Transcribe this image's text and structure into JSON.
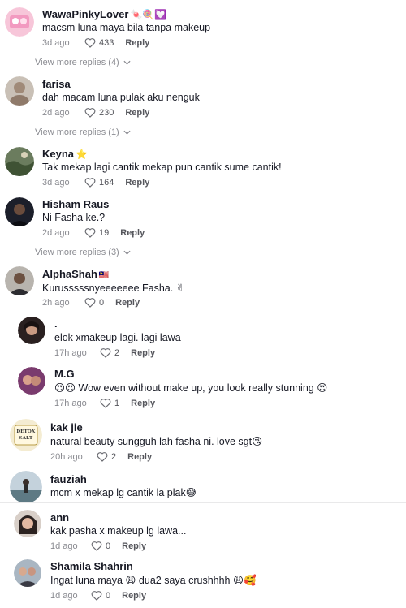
{
  "comments": [
    {
      "name": "WawaPinkyLover",
      "name_emoji": "🍬🍭💟",
      "text": "macsm luna maya bila tanpa makeup",
      "time": "3d ago",
      "likes": "433",
      "reply": "Reply"
    },
    {
      "name": "farisa",
      "name_emoji": "",
      "text": "dah macam luna pulak aku nenguk",
      "time": "2d ago",
      "likes": "230",
      "reply": "Reply"
    },
    {
      "name": "Keyna",
      "name_emoji": "⭐",
      "text": "Tak mekap lagi cantik mekap pun cantik sume cantik!",
      "time": "3d ago",
      "likes": "164",
      "reply": "Reply"
    },
    {
      "name": "Hisham Raus",
      "name_emoji": "",
      "text": "Ni Fasha ke.?",
      "time": "2d ago",
      "likes": "19",
      "reply": "Reply"
    },
    {
      "name": "AlphaShah",
      "name_emoji": "🇲🇾",
      "text": "Kurusssssnyeeeeeee Fasha. ✌",
      "time": "2h ago",
      "likes": "0",
      "reply": "Reply"
    },
    {
      "name": ".",
      "name_emoji": "",
      "text": "elok xmakeup lagi. lagi lawa",
      "time": "17h ago",
      "likes": "2",
      "reply": "Reply"
    },
    {
      "name": "M.G",
      "name_emoji": "",
      "text": "😍😍 Wow even without make up, you look really stunning 😍",
      "time": "17h ago",
      "likes": "1",
      "reply": "Reply"
    },
    {
      "name": "kak jie",
      "name_emoji": "",
      "text": "natural beauty sungguh lah fasha ni. love sgt😘",
      "time": "20h ago",
      "likes": "2",
      "reply": "Reply"
    },
    {
      "name": "fauziah",
      "name_emoji": "",
      "text": "mcm x mekap lg cantik la plak😅",
      "time": "",
      "likes": "",
      "reply": ""
    },
    {
      "name": "ann",
      "name_emoji": "",
      "text": "kak pasha x makeup lg lawa...",
      "time": "1d ago",
      "likes": "0",
      "reply": "Reply"
    },
    {
      "name": "Shamila Shahrin",
      "name_emoji": "",
      "text": "Ingat luna maya 😩 dua2 saya crushhhh 😩🥰",
      "time": "1d ago",
      "likes": "0",
      "reply": "Reply"
    }
  ],
  "view_more": [
    "View more replies (4)",
    "View more replies (1)",
    "View more replies (3)"
  ],
  "kakjie_avatar_text": {
    "line1": "DETOX",
    "line2": "SALT"
  },
  "colors": {
    "name": "#161823",
    "meta": "#8a8b91",
    "divider": "#e9e9ea"
  }
}
